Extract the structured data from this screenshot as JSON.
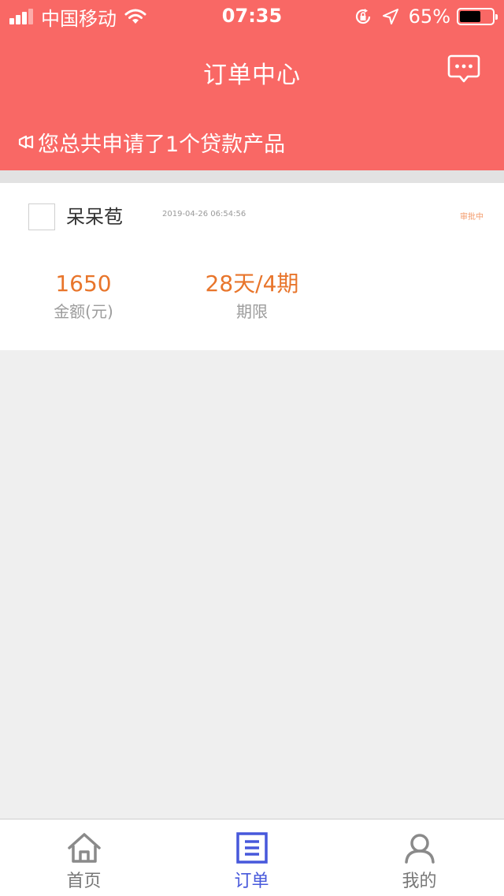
{
  "status_bar": {
    "carrier": "中国移动",
    "time": "07:35",
    "battery_text": "65%",
    "battery_level": 0.65
  },
  "header": {
    "title": "订单中心",
    "notice": "您总共申请了1个贷款产品"
  },
  "order": {
    "product_name": "呆呆苞",
    "time": "2019-04-26 06:54:56",
    "status": "审批中",
    "amount_value": "1650",
    "amount_label": "金额(元)",
    "term_value": "28天/4期",
    "term_label": "期限"
  },
  "tabs": [
    {
      "label": "首页",
      "icon": "home-icon",
      "active": false
    },
    {
      "label": "订单",
      "icon": "order-list-icon",
      "active": true
    },
    {
      "label": "我的",
      "icon": "person-icon",
      "active": false
    }
  ],
  "colors": {
    "header_bg": "#f96865",
    "accent_orange": "#e8752b",
    "status_orange": "#f39a6a",
    "tab_active": "#4758db",
    "tab_inactive": "#777777"
  }
}
